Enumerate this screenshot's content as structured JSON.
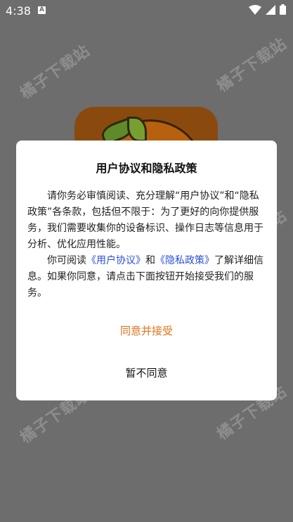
{
  "status_bar": {
    "time": "4:38",
    "notification_glyph": "A",
    "icons": [
      "wifi-icon",
      "signal-icon",
      "battery-icon"
    ]
  },
  "watermark": {
    "text": "橘子下载站"
  },
  "dialog": {
    "title": "用户协议和隐私政策",
    "paragraph1": "请你务必审慎阅读、充分理解“用户协议”和“隐私政策”各条款，包括但不限于：为了更好的向你提供服务，我们需要收集你的设备标识、操作日志等信息用于分析、优化应用性能。",
    "p2_prefix": "你可阅读",
    "user_agreement_link": "《用户协议》",
    "p2_and": "和",
    "privacy_policy_link": "《隐私政策》",
    "p2_suffix": "了解详细信息。如果你同意，请点击下面按钮开始接受我们的服务。",
    "accept_label": "同意并接受",
    "decline_label": "暂不同意"
  },
  "colors": {
    "accept": "#e0731b",
    "link": "#2a4fd6",
    "scrim": "#6d6d6d"
  }
}
